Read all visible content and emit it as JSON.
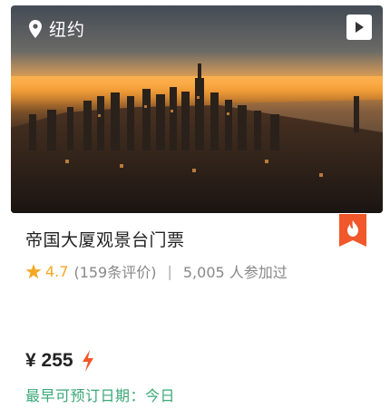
{
  "hero": {
    "location": "纽约",
    "icons": {
      "location": "map-pin-icon",
      "video": "play-video-icon"
    }
  },
  "badge": {
    "icon": "flame-icon",
    "color": "#f0572a"
  },
  "product": {
    "title": "帝国大厦观景台门票",
    "rating": "4.7",
    "reviews": "(159条评价)",
    "separator": "|",
    "participants": "5,005 人参加过",
    "price": "¥ 255",
    "price_icon": "lightning-icon",
    "availability": "最早可预订日期：今日"
  },
  "colors": {
    "star": "#f5a623",
    "availability": "#3aa877",
    "badge": "#f0572a",
    "lightning": "#f0572a"
  }
}
